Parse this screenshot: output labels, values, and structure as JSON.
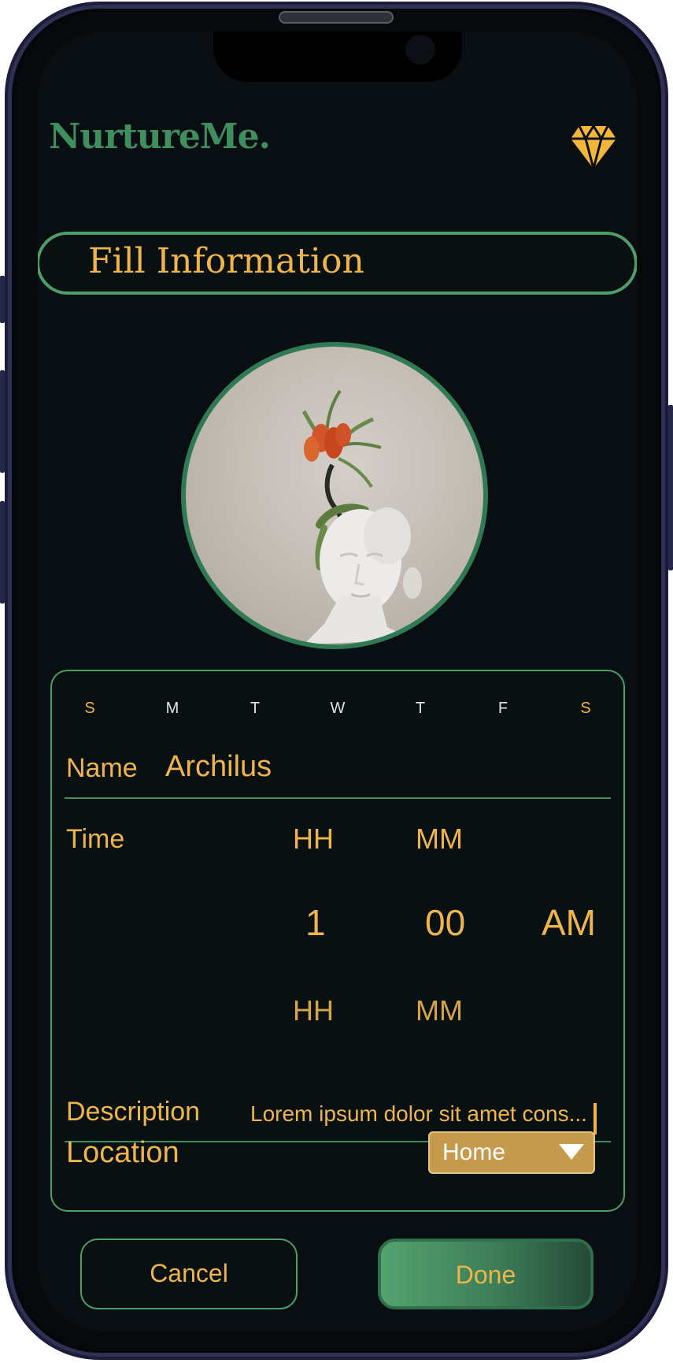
{
  "header": {
    "logo": "NurtureMe.",
    "premium_icon": "diamond-icon"
  },
  "title": "Fill Information",
  "profile": {
    "image": "plaster-bust-with-flower"
  },
  "days": [
    {
      "label": "S",
      "weekend": true
    },
    {
      "label": "M",
      "weekend": false
    },
    {
      "label": "T",
      "weekend": false
    },
    {
      "label": "W",
      "weekend": false
    },
    {
      "label": "T",
      "weekend": false
    },
    {
      "label": "F",
      "weekend": false
    },
    {
      "label": "S",
      "weekend": true
    }
  ],
  "form": {
    "name_label": "Name",
    "name_value": "Archilus",
    "time_label": "Time",
    "time": {
      "hh_header": "HH",
      "mm_header": "MM",
      "hour": "1",
      "minute": "00",
      "period": "AM",
      "hh_footer": "HH",
      "mm_footer": "MM"
    },
    "description_label": "Description",
    "description_value": "Lorem ipsum dolor sit amet cons...",
    "location_label": "Location",
    "location_value": "Home"
  },
  "buttons": {
    "cancel": "Cancel",
    "done": "Done"
  },
  "colors": {
    "accent_green": "#4f9d69",
    "accent_gold": "#f0b54a",
    "background": "#080e12",
    "dropdown": "#c69a4c"
  }
}
